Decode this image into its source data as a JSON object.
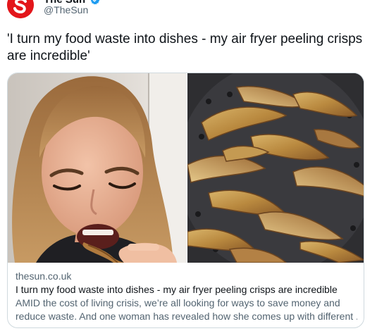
{
  "author": {
    "name": "The Sun",
    "handle": "@TheSun",
    "avatar_letter": "S",
    "brand_color": "#e3161b",
    "verified_color": "#1d9bf0"
  },
  "tweet": {
    "text": "'I turn my food waste into dishes - my air fryer peeling crisps are incredible'"
  },
  "card": {
    "domain": "thesun.co.uk",
    "title": "I turn my food waste into dishes - my air fryer peeling crisps are incredible",
    "description_line1": "AMID the cost of living crisis, we’re all looking for ways to save money and",
    "description_line2": "reduce waste. And one woman has revealed how she comes up with different ...",
    "images": [
      {
        "subject": "woman eating a potato peel crisp"
      },
      {
        "subject": "air fryer basket full of crispy potato peelings"
      }
    ]
  },
  "colors": {
    "text_primary": "#0f1419",
    "text_secondary": "#536471",
    "border": "#cfd9de"
  }
}
